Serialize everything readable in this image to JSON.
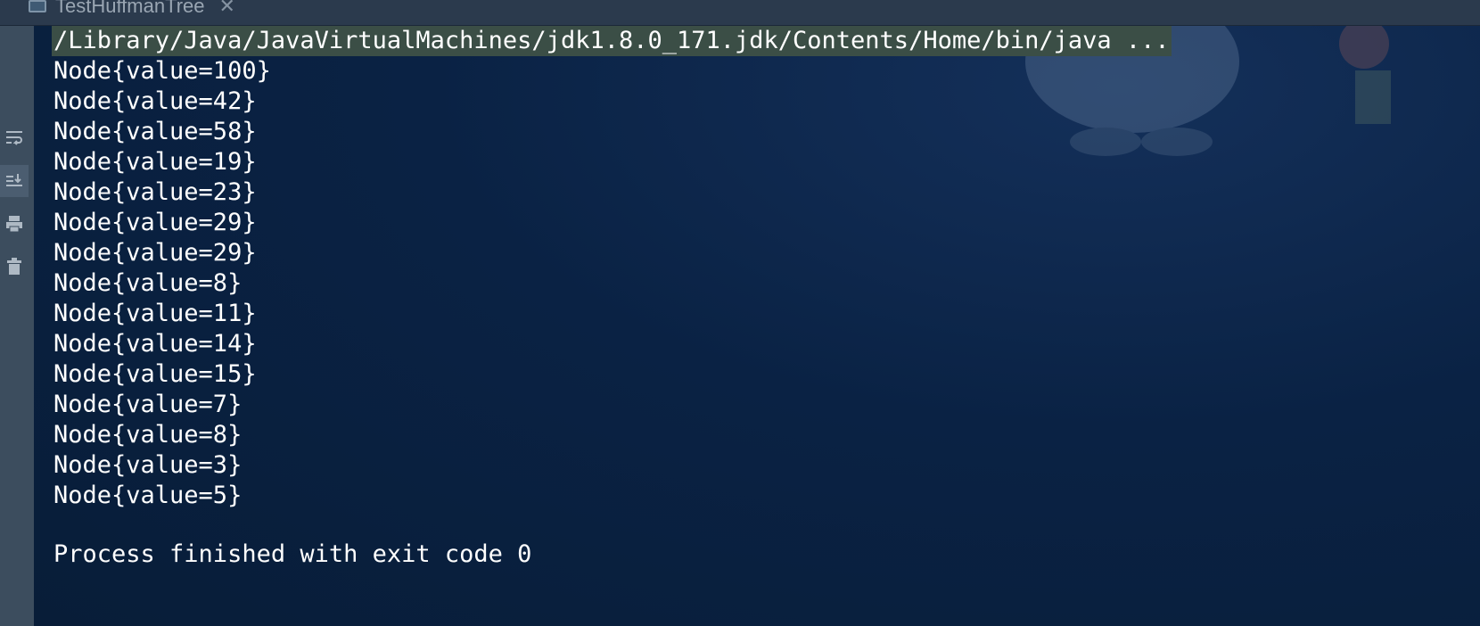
{
  "tab": {
    "title": "TestHuffmanTree",
    "close_glyph": "✕"
  },
  "gutter_tools": [
    {
      "name": "soft-wrap-icon"
    },
    {
      "name": "scroll-to-end-icon"
    },
    {
      "name": "print-icon"
    },
    {
      "name": "trash-icon"
    }
  ],
  "console": {
    "command": "/Library/Java/JavaVirtualMachines/jdk1.8.0_171.jdk/Contents/Home/bin/java ...",
    "lines": [
      "Node{value=100}",
      "Node{value=42}",
      "Node{value=58}",
      "Node{value=19}",
      "Node{value=23}",
      "Node{value=29}",
      "Node{value=29}",
      "Node{value=8}",
      "Node{value=11}",
      "Node{value=14}",
      "Node{value=15}",
      "Node{value=7}",
      "Node{value=8}",
      "Node{value=3}",
      "Node{value=5}"
    ],
    "exit_message": "Process finished with exit code 0"
  },
  "colors": {
    "console_bg": "#0b2340",
    "command_highlight": "#3b4e46",
    "text": "#ffffff"
  }
}
